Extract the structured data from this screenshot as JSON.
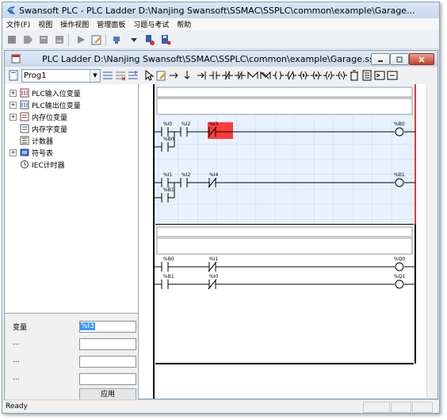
{
  "app_title": "Swansoft PLC - PLC Ladder  D:\\Nanjing Swansoft\\SSMAC\\SSPLC\\common\\example\\Garage...",
  "menu": [
    "文件(F)",
    "视图",
    "操作视图",
    "管理面板",
    "习题与考试",
    "帮助"
  ],
  "doc_window": {
    "title": "PLC Ladder  D:\\Nanjing Swansoft\\SSMAC\\SSPLC\\common\\example\\Garage.ssp"
  },
  "program_combo": {
    "value": "Prog1"
  },
  "tree": {
    "items": [
      {
        "label": "PLC输入位变量",
        "expander": "+",
        "icon": "io-input-icon"
      },
      {
        "label": "PLC输出位变量",
        "expander": "+",
        "icon": "io-output-icon"
      },
      {
        "label": "内存位变量",
        "expander": "+",
        "icon": "memory-bit-icon"
      },
      {
        "label": "内存字变量",
        "expander": "",
        "icon": "memory-word-icon"
      },
      {
        "label": "计数器",
        "expander": "",
        "icon": "counter-icon"
      },
      {
        "label": "符号表",
        "expander": "+",
        "icon": "symbol-table-icon"
      },
      {
        "label": "IEC计时器",
        "expander": "",
        "icon": "timer-icon"
      }
    ]
  },
  "properties": {
    "variable_label": "变量",
    "variable_value": "%I3",
    "row2_label": "...",
    "row3_label": "...",
    "row4_label": "...",
    "apply_label": "应用"
  },
  "ladder": {
    "block1": {
      "rung1": {
        "contacts": [
          "%I0",
          "%I2",
          "%I3"
        ],
        "parallel": "%B0",
        "coil": "%B0"
      },
      "rung2": {
        "contacts": [
          "%I1",
          "%I2",
          "%I4"
        ],
        "parallel": "%B1",
        "coil": "%B1"
      }
    },
    "block2": {
      "rung1": {
        "contacts": [
          "%B0",
          "%I1"
        ],
        "coil": "%Q0"
      },
      "rung2": {
        "contacts": [
          "%B1",
          "%I0"
        ],
        "coil": "%Q1"
      }
    },
    "selected_contact": "%I3",
    "highlight_color": "#ff3b3b",
    "grid_color": "#c8dff0"
  },
  "status": {
    "text": "Ready"
  }
}
